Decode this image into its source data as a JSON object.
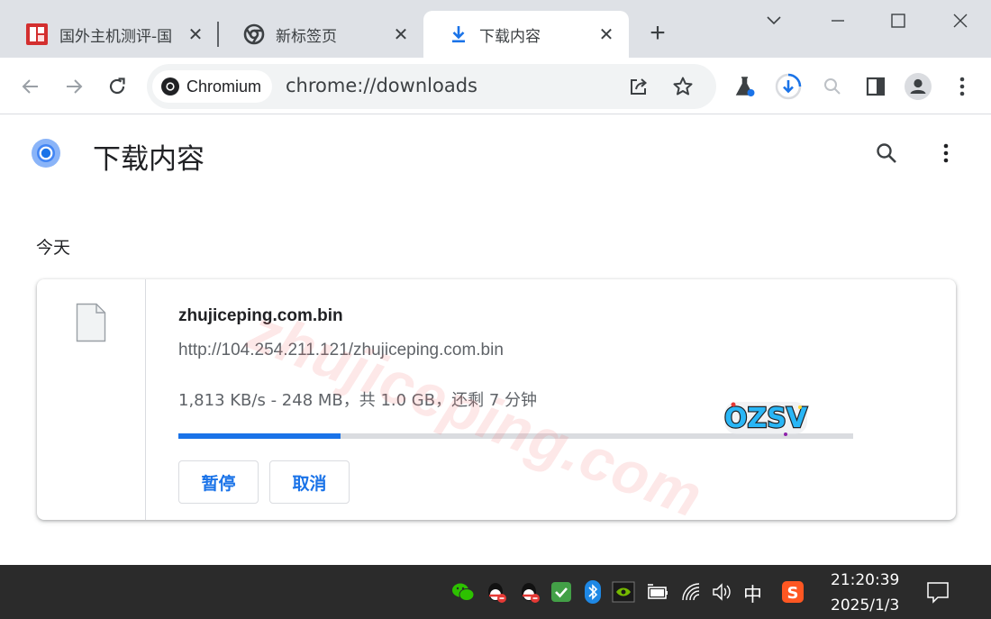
{
  "tabs": [
    {
      "title": "国外主机测评-国",
      "icon": "site-favicon"
    },
    {
      "title": "新标签页",
      "icon": "chrome-logo-icon"
    },
    {
      "title": "下载内容",
      "icon": "download-icon"
    }
  ],
  "toolbar": {
    "site_chip": "Chromium",
    "url": "chrome://downloads"
  },
  "page": {
    "title": "下载内容",
    "section_date": "今天"
  },
  "download": {
    "file_name": "zhujiceping.com.bin",
    "url": "http://104.254.211.121/zhujiceping.com.bin",
    "status": "1,813 KB/s - 248 MB，共 1.0 GB，还剩 7 分钟",
    "progress_fraction": 0.24,
    "pause_label": "暂停",
    "cancel_label": "取消"
  },
  "watermark": "zhujiceping.com",
  "sticker_text": "OZSV",
  "taskbar": {
    "ime": "中",
    "time": "21:20:39",
    "date": "2025/1/3"
  },
  "colors": {
    "accent": "#1a73e8",
    "tabstrip": "#dee1e6",
    "taskbar": "#2b2b2b"
  }
}
